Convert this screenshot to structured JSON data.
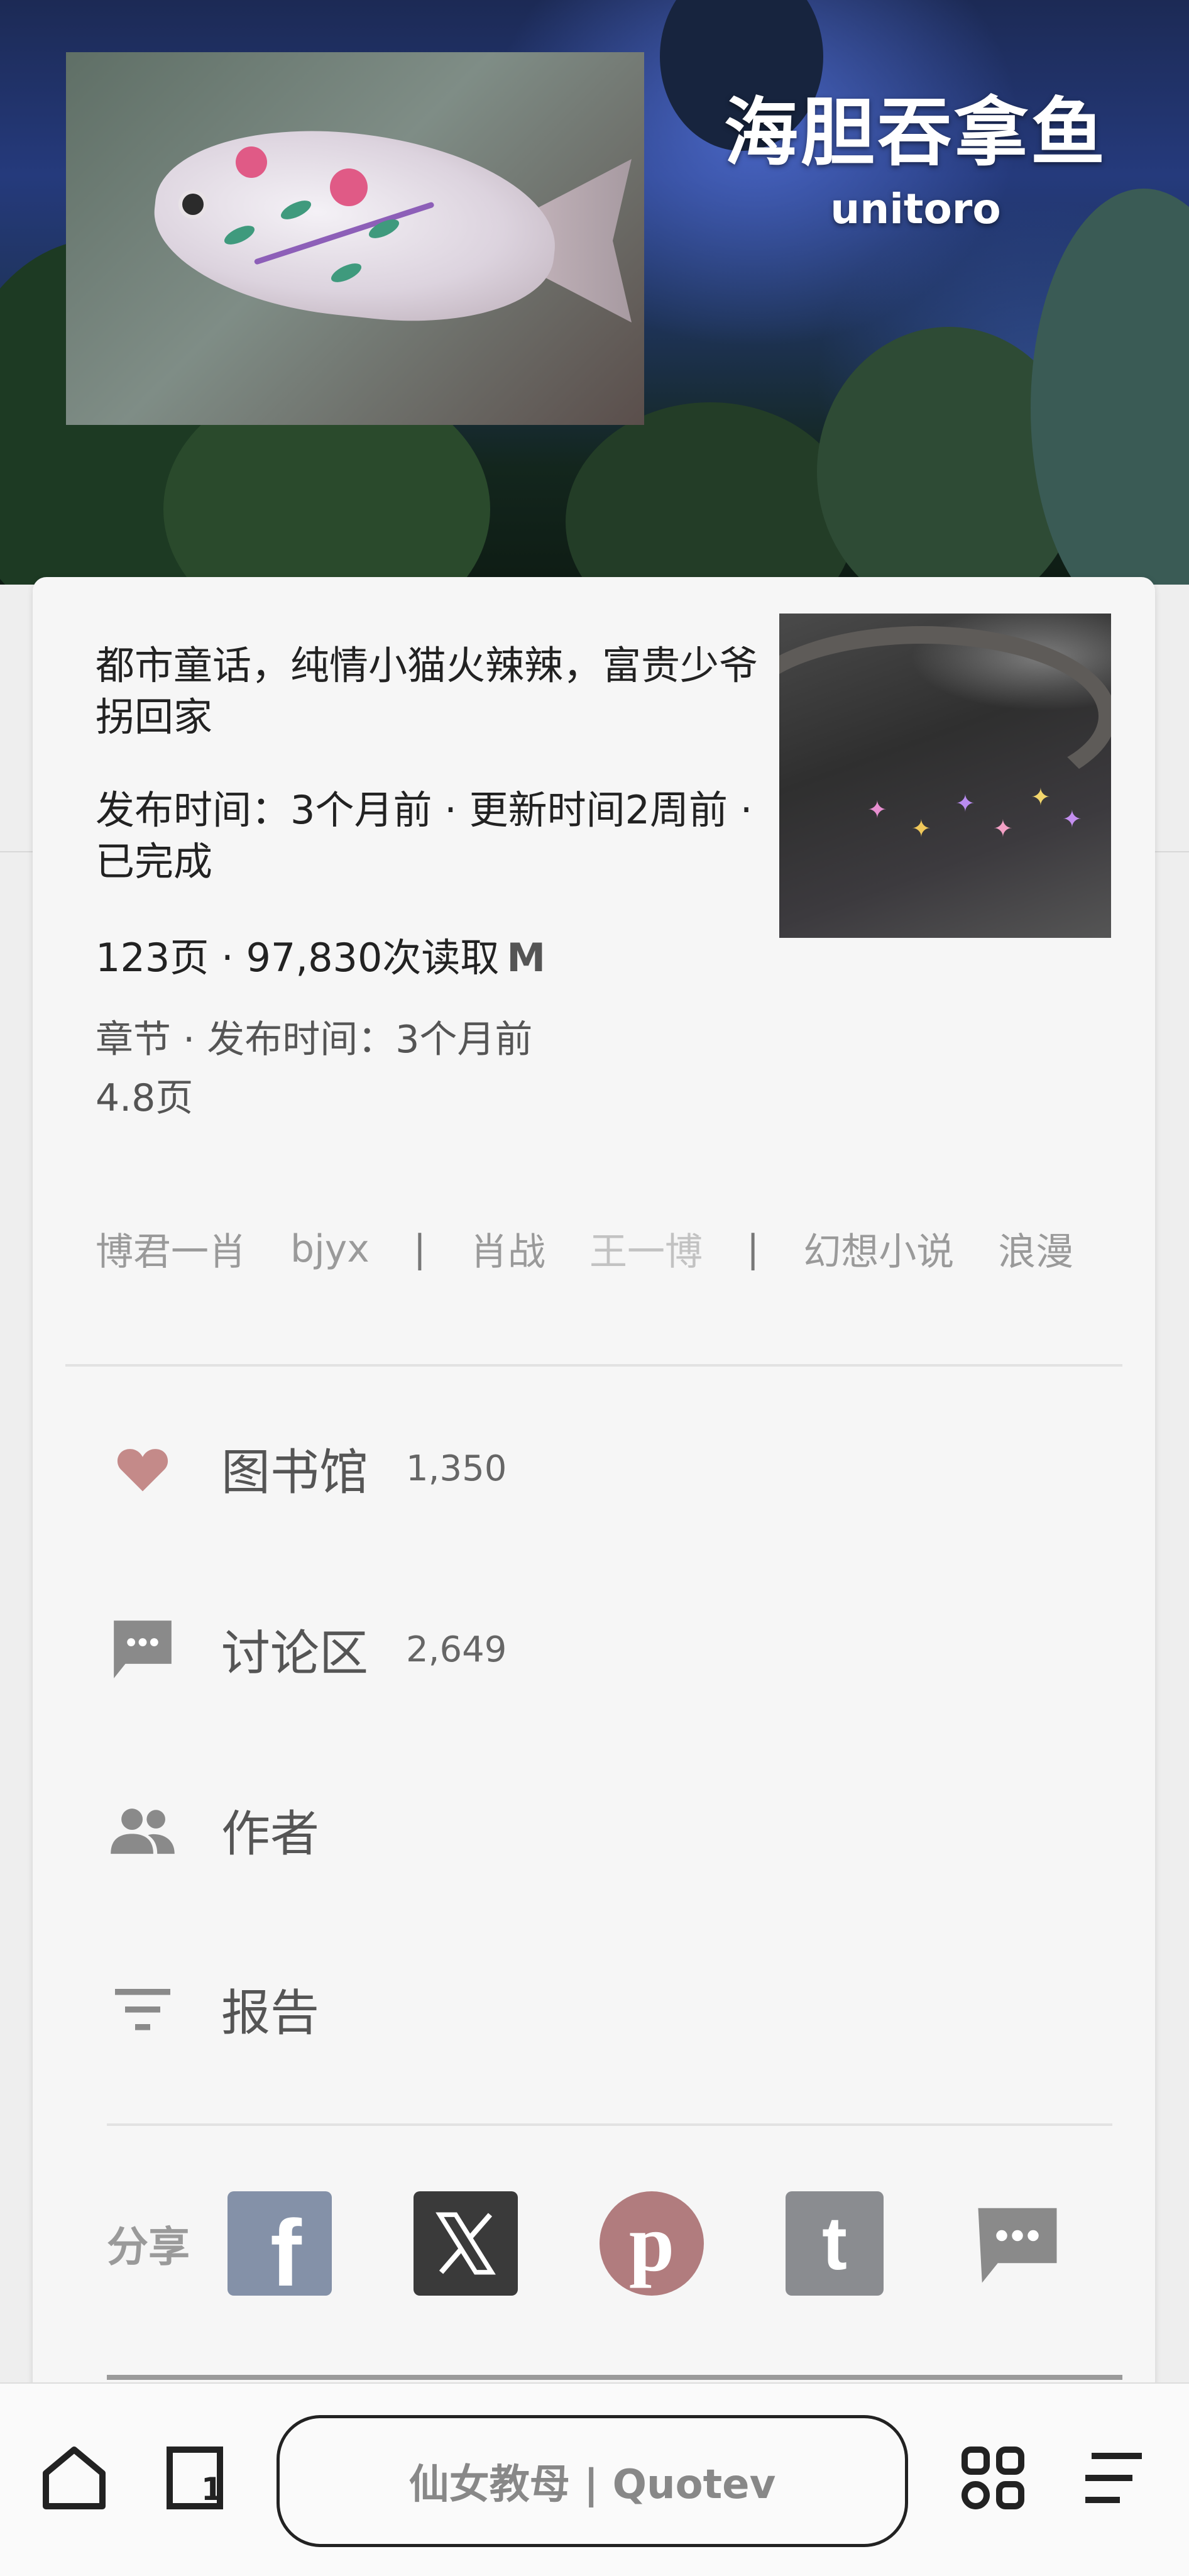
{
  "header": {
    "title": "海胆吞拿鱼",
    "author": "unitoro",
    "cover_alt": "painted-fish-cover"
  },
  "story": {
    "description": "都市童话，纯情小猫火辣辣，富贵少爷拐回家",
    "publish_line": "发布时间：3个月前 · 更新时间2周前 · 已完成",
    "stats": "123页 · 97,830次读取",
    "rating": "M",
    "chapter_line": "章节 · 发布时间：3个月前",
    "chapter_pages": "4.8页"
  },
  "tags": {
    "group1": [
      "博君一肖",
      "bjyx"
    ],
    "group2": [
      "肖战",
      "王一博"
    ],
    "group3": [
      "幻想小说",
      "浪漫"
    ]
  },
  "menu": {
    "library": {
      "label": "图书馆",
      "count": "1,350",
      "icon": "heart-icon"
    },
    "discussion": {
      "label": "讨论区",
      "count": "2,649",
      "icon": "chat-icon"
    },
    "author": {
      "label": "作者",
      "icon": "people-icon"
    },
    "report": {
      "label": "报告",
      "icon": "filter-icon"
    }
  },
  "share": {
    "label": "分享",
    "buttons": [
      "facebook",
      "x",
      "pinterest",
      "tumblr",
      "message"
    ]
  },
  "browser": {
    "url_text": "仙女教母 | Quotev",
    "tab_count": "1"
  },
  "colors": {
    "heart": "#c48a89",
    "facebook": "#8491a8",
    "x": "#3a3a3a",
    "pinterest": "#b17c7e",
    "tumblr": "#8a8c90",
    "icon_gray": "#8a8a8a"
  }
}
